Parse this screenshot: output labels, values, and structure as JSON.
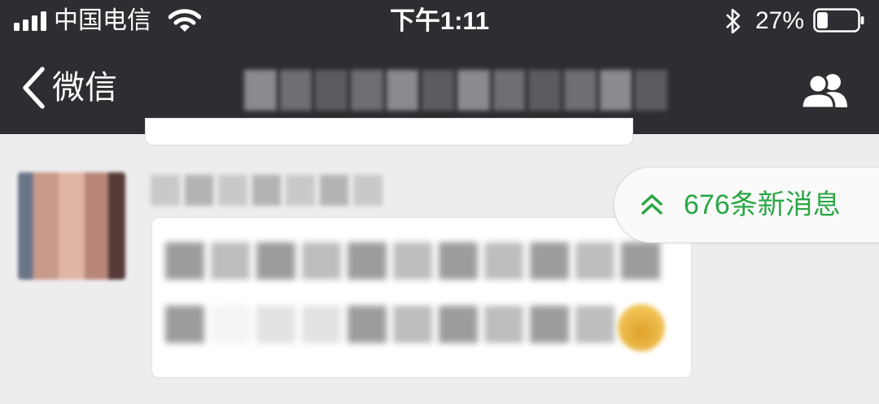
{
  "status_bar": {
    "carrier": "中国电信",
    "time": "下午1:11",
    "battery_percent": "27%",
    "battery_level": 0.27,
    "icons": [
      "signal-icon",
      "wifi-icon",
      "bluetooth-icon",
      "battery-icon"
    ]
  },
  "nav_bar": {
    "back_label": "微信",
    "title": "",
    "icons": [
      "chevron-left-icon",
      "group-members-icon"
    ]
  },
  "chat": {
    "new_messages_label": "676条新消息",
    "new_messages_icon": "double-chevron-up-icon",
    "accent_color": "#2aa745"
  }
}
